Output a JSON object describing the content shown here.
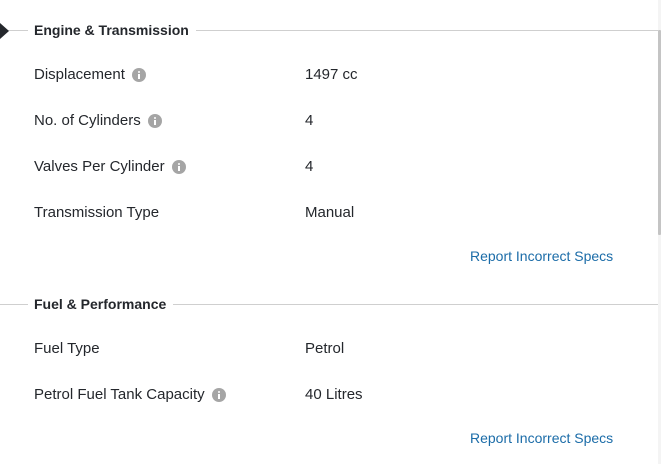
{
  "sections": [
    {
      "title": "Engine & Transmission",
      "rows": [
        {
          "label": "Displacement",
          "value": "1497 cc",
          "info": true
        },
        {
          "label": "No. of Cylinders",
          "value": "4",
          "info": true
        },
        {
          "label": "Valves Per Cylinder",
          "value": "4",
          "info": true
        },
        {
          "label": "Transmission Type",
          "value": "Manual",
          "info": false
        }
      ],
      "report_label": "Report Incorrect Specs"
    },
    {
      "title": "Fuel & Performance",
      "rows": [
        {
          "label": "Fuel Type",
          "value": "Petrol",
          "info": false
        },
        {
          "label": "Petrol Fuel Tank Capacity",
          "value": "40 Litres",
          "info": true
        }
      ],
      "report_label": "Report Incorrect Specs"
    }
  ],
  "colors": {
    "link": "#1b6ca8",
    "text": "#24272c",
    "rule": "#cfcfcf",
    "info_icon": "#a5a5a5"
  },
  "icons": {
    "section_marker": "section-marker-icon",
    "info": "info-icon"
  }
}
